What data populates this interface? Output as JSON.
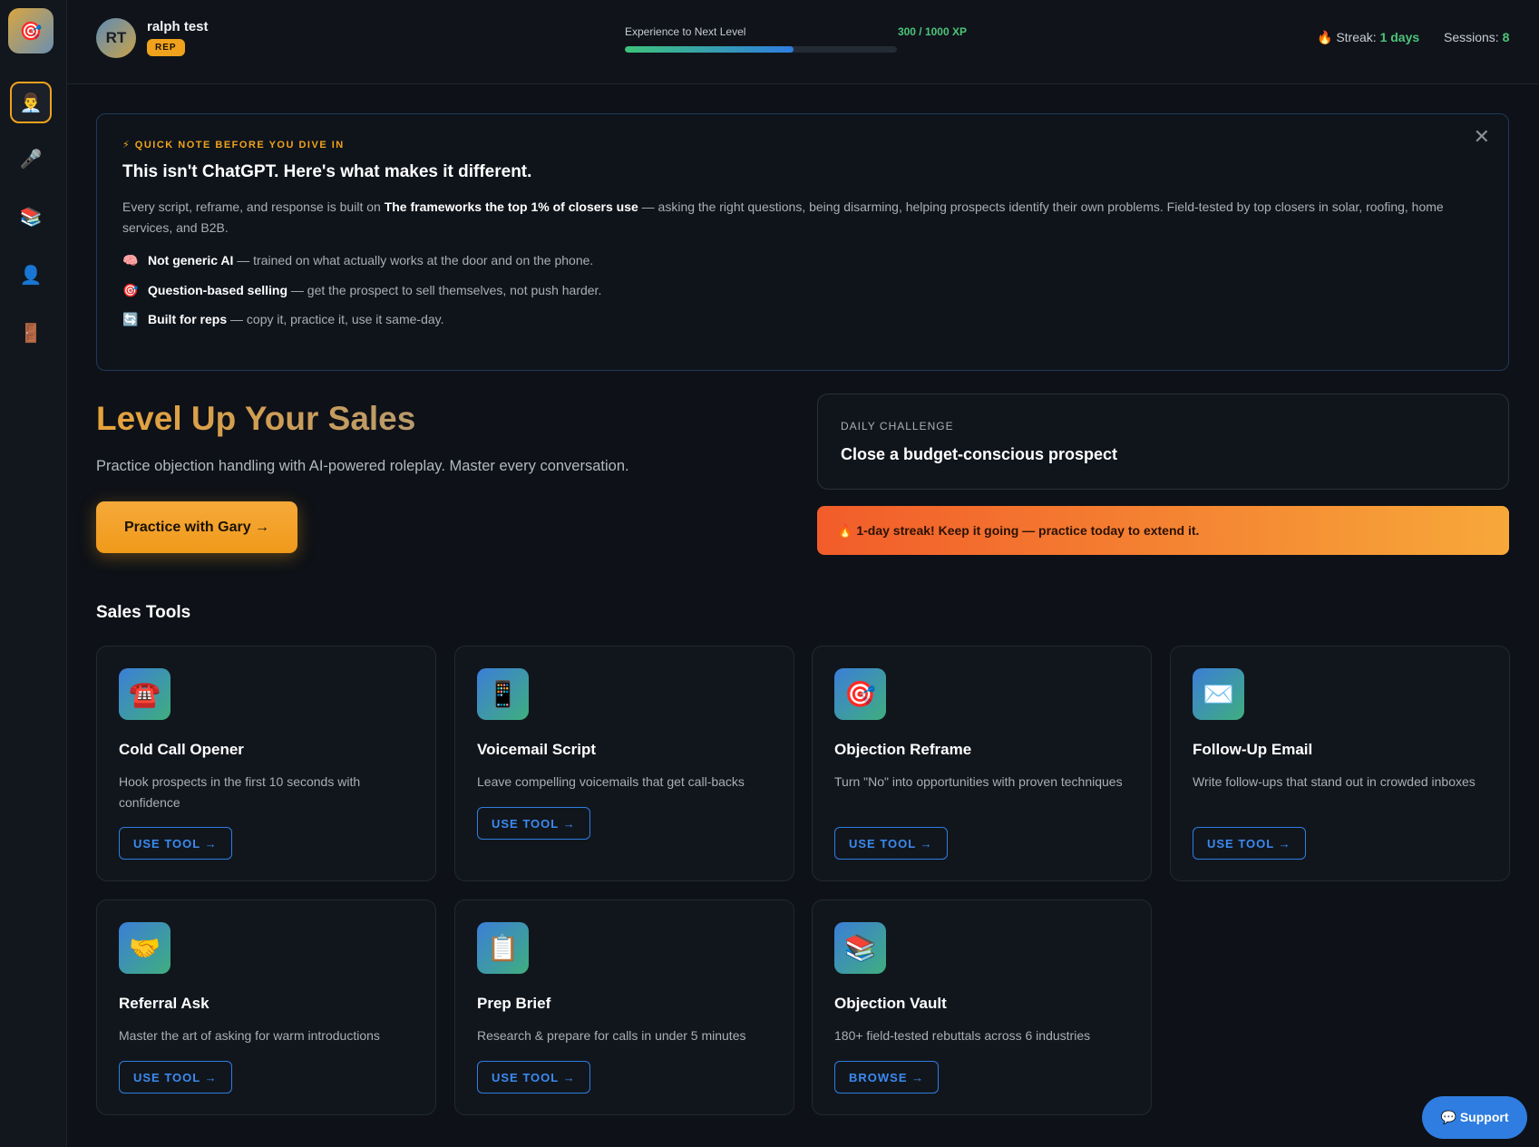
{
  "sidebar": {
    "logo_icon": "🎯",
    "items": [
      {
        "name": "profile",
        "icon": "👨‍💼",
        "active": true
      },
      {
        "name": "practice",
        "icon": "🎤"
      },
      {
        "name": "library",
        "icon": "📚"
      },
      {
        "name": "account",
        "icon": "👤"
      },
      {
        "name": "logout",
        "icon": "🚪"
      }
    ]
  },
  "header": {
    "avatar_initials": "RT",
    "user_name": "ralph test",
    "badge": "REP",
    "xp_label": "Experience to Next Level",
    "xp_value": "300 / 1000 XP",
    "xp_progress": 0.62,
    "streak_icon": "🔥",
    "streak_label": "Streak:",
    "streak_value": "1 days",
    "sessions_label": "Sessions:",
    "sessions_value": "8"
  },
  "note": {
    "kicker": "⚡ QUICK NOTE BEFORE YOU DIVE IN",
    "title": "This isn't ChatGPT. Here's what makes it different.",
    "body_pre": "Every script, reframe, and response is built on ",
    "body_bold": "The frameworks the top 1% of closers use",
    "body_post": " — asking the right questions, being disarming, helping prospects identify their own problems. Field-tested by top closers in solar, roofing, home services, and B2B.",
    "bullets": [
      {
        "icon": "🧠",
        "bold": "Not generic AI",
        "text": " — trained on what actually works at the door and on the phone."
      },
      {
        "icon": "🎯",
        "bold": "Question-based selling",
        "text": " — get the prospect to sell themselves, not push harder."
      },
      {
        "icon": "🔄",
        "bold": "Built for reps",
        "text": " — copy it, practice it, use it same-day."
      }
    ]
  },
  "hero": {
    "title": "Level Up Your Sales",
    "subtitle": "Practice objection handling with AI-powered roleplay. Master every conversation.",
    "button": "Practice with Gary →"
  },
  "challenge": {
    "label": "DAILY CHALLENGE",
    "text": "Close a budget-conscious prospect"
  },
  "streak_banner": "🔥 1-day streak! Keep it going — practice today to extend it.",
  "tools": {
    "section_title": "Sales Tools",
    "cards": [
      {
        "icon": "☎️",
        "title": "Cold Call Opener",
        "desc": "Hook prospects in the first 10 seconds with confidence",
        "button": "USE TOOL →"
      },
      {
        "icon": "📱",
        "title": "Voicemail Script",
        "desc": "Leave compelling voicemails that get call-backs",
        "button": "USE TOOL →"
      },
      {
        "icon": "🎯",
        "title": "Objection Reframe",
        "desc": "Turn \"No\" into opportunities with proven techniques",
        "button": "USE TOOL →"
      },
      {
        "icon": "✉️",
        "title": "Follow-Up Email",
        "desc": "Write follow-ups that stand out in crowded inboxes",
        "button": "USE TOOL →"
      },
      {
        "icon": "🤝",
        "title": "Referral Ask",
        "desc": "Master the art of asking for warm introductions",
        "button": "USE TOOL →"
      },
      {
        "icon": "📋",
        "title": "Prep Brief",
        "desc": "Research & prepare for calls in under 5 minutes",
        "button": "USE TOOL →"
      },
      {
        "icon": "📚",
        "title": "Objection Vault",
        "desc": "180+ field-tested rebuttals across 6 industries",
        "button": "BROWSE →"
      }
    ]
  },
  "support_button": "💬 Support",
  "colors": {
    "accent": "#f0a21c",
    "link": "#2f7de0",
    "success": "#4cc47a",
    "background": "#0e1117"
  }
}
